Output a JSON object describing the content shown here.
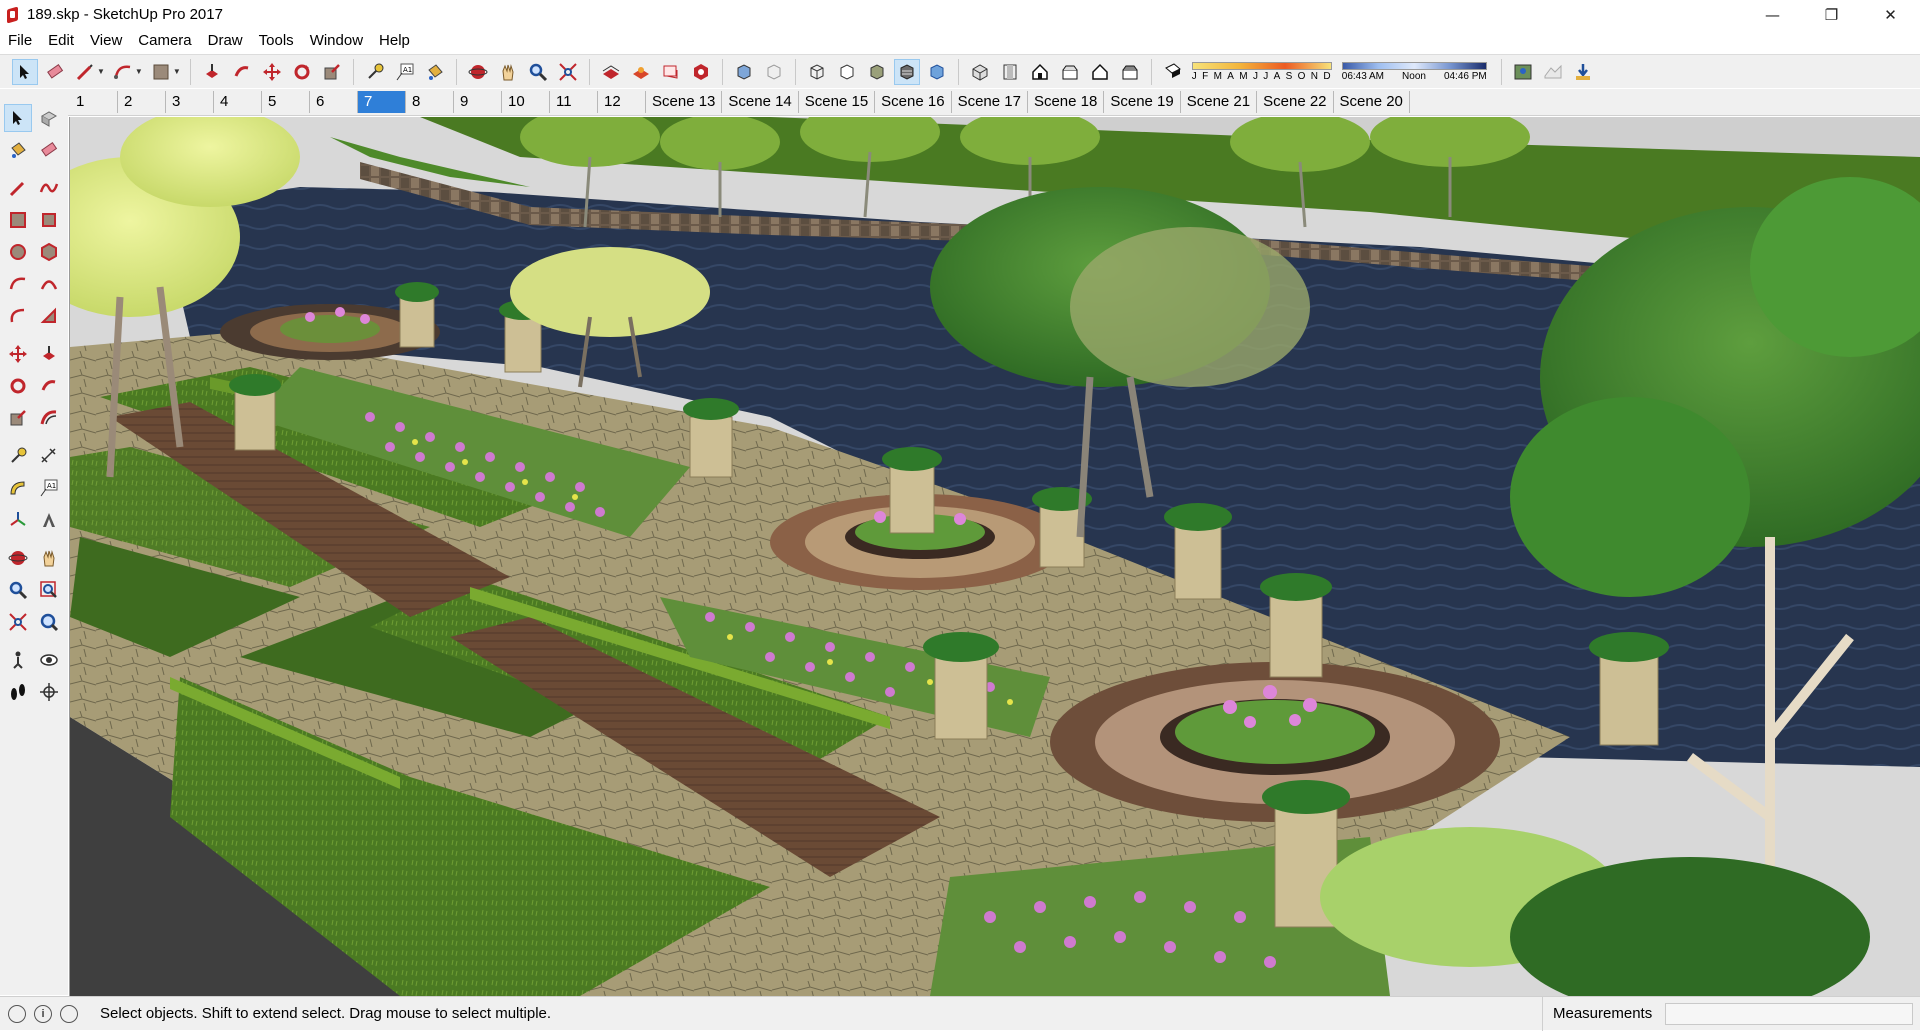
{
  "window": {
    "title": "189.skp - SketchUp Pro 2017",
    "minimize": "—",
    "maximize": "❐",
    "close": "✕"
  },
  "menu": [
    "File",
    "Edit",
    "View",
    "Camera",
    "Draw",
    "Tools",
    "Window",
    "Help"
  ],
  "shadow": {
    "months": [
      "J",
      "F",
      "M",
      "A",
      "M",
      "J",
      "J",
      "A",
      "S",
      "O",
      "N",
      "D"
    ],
    "time_start": "06:43 AM",
    "time_mid": "Noon",
    "time_end": "04:46 PM"
  },
  "scenes": {
    "tabs": [
      "1",
      "2",
      "3",
      "4",
      "5",
      "6",
      "7",
      "8",
      "9",
      "10",
      "11",
      "12",
      "Scene 13",
      "Scene 14",
      "Scene 15",
      "Scene 16",
      "Scene 17",
      "Scene 18",
      "Scene 19",
      "Scene 21",
      "Scene 22",
      "Scene 20"
    ],
    "active": "7"
  },
  "status": {
    "message": "Select objects. Shift to extend select. Drag mouse to select multiple.",
    "measurements_label": "Measurements",
    "measurements_value": "",
    "info_glyph": "i"
  },
  "colors": {
    "accent": "#2f7fd8",
    "toolbar_bg": "#f0f0f0",
    "water": "#27354f",
    "lawn": "#3e6b1f",
    "path": "#6b4a33",
    "paving": "#a59c78"
  }
}
